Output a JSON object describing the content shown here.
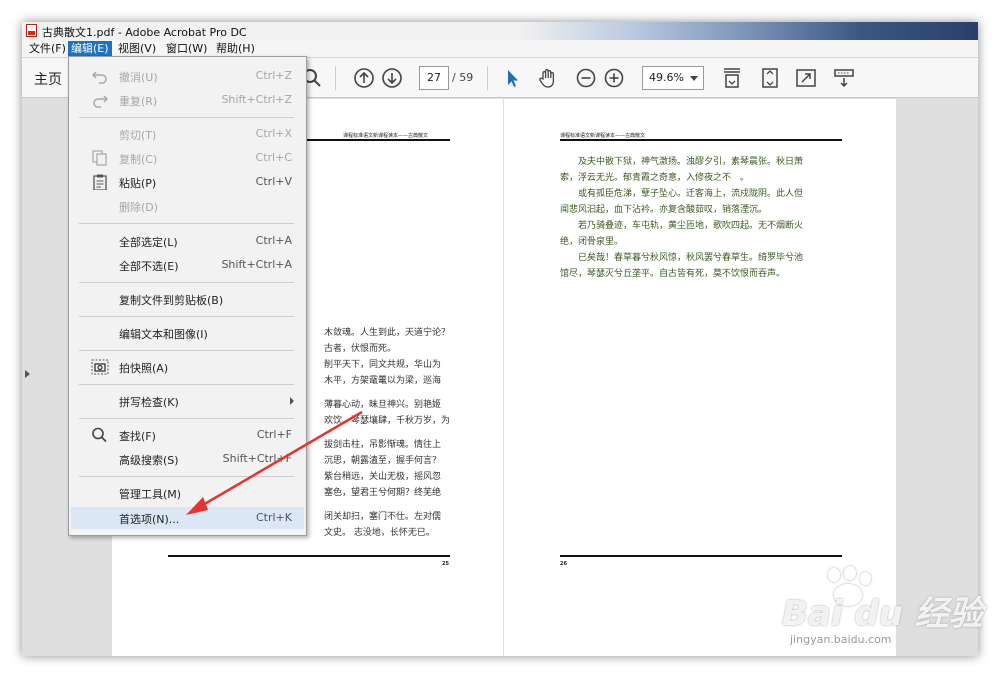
{
  "window": {
    "title": "古典散文1.pdf - Adobe Acrobat Pro DC"
  },
  "menubar": [
    {
      "label": "文件(F)",
      "active": false
    },
    {
      "label": "编辑(E)",
      "active": true
    },
    {
      "label": "视图(V)",
      "active": false
    },
    {
      "label": "窗口(W)",
      "active": false
    },
    {
      "label": "帮助(H)",
      "active": false
    }
  ],
  "toolbar": {
    "home_label": "主页",
    "page_current": "27",
    "page_total": "/ 59",
    "zoom": "49.6%"
  },
  "edit_menu": {
    "undo": {
      "label": "撤消(U)",
      "shortcut": "Ctrl+Z"
    },
    "redo": {
      "label": "重复(R)",
      "shortcut": "Shift+Ctrl+Z"
    },
    "cut": {
      "label": "剪切(T)",
      "shortcut": "Ctrl+X"
    },
    "copy": {
      "label": "复制(C)",
      "shortcut": "Ctrl+C"
    },
    "paste": {
      "label": "粘贴(P)",
      "shortcut": "Ctrl+V"
    },
    "delete": {
      "label": "删除(D)",
      "shortcut": ""
    },
    "select_all": {
      "label": "全部选定(L)",
      "shortcut": "Ctrl+A"
    },
    "deselect_all": {
      "label": "全部不选(E)",
      "shortcut": "Shift+Ctrl+A"
    },
    "copy_file_clipboard": {
      "label": "复制文件到剪贴板(B)",
      "shortcut": ""
    },
    "edit_text_images": {
      "label": "编辑文本和图像(I)",
      "shortcut": ""
    },
    "snapshot": {
      "label": "拍快照(A)",
      "shortcut": ""
    },
    "spell_check": {
      "label": "拼写检查(K)",
      "shortcut": ""
    },
    "find": {
      "label": "查找(F)",
      "shortcut": "Ctrl+F"
    },
    "advanced_search": {
      "label": "高级搜索(S)",
      "shortcut": "Shift+Ctrl+F"
    },
    "manage_tools": {
      "label": "管理工具(M)",
      "shortcut": ""
    },
    "preferences": {
      "label": "首选项(N)...",
      "shortcut": "Ctrl+K"
    }
  },
  "left_page": {
    "header": "课程标准语文新课程读本——古典散文",
    "page_number": "25",
    "lines": [
      "木敛魂。人生到此，天道宁论？",
      "古者，伏恨而死。",
      "削平天下，同文共规，华山为",
      "木平，方架鼋鼍以为梁，巡海",
      "薄暮心动，昧旦神兴。别艳姬",
      "欢饮，琴瑟壤肆，千秋万岁，为",
      "拔剑击柱，吊影惭魂。情往上",
      "沉思，朝露溘至，握手何言？",
      "紫台稍远，关山无极，摇风忽",
      "塞色，望君王兮何期？终芜绝",
      "闭关却扫，塞门不仕。左对儒",
      "文史。 志没地，长怀无已。"
    ]
  },
  "right_page": {
    "header": "课程标准语文新课程读本——古典散文",
    "page_number": "26",
    "lines": [
      "及夫中散下狱，神气激扬。浊醪夕引，素琴晨张。秋日萧",
      "索，浮云无光。郁青霞之奇意，入修夜之不　。",
      "或有孤臣危涕，孽子坠心。迁客海上，流戍陇阴。此人但",
      "闻悲风汩起，血下沾衿。亦复含酸茹叹，销落湮沉。",
      "若乃骑叠迹，车屯轨，黄尘匝地，歌吹四起。无不烟断火",
      "绝，闭骨泉里。",
      "已矣哉！春草暮兮秋风惊，秋风罢兮春草生。绮罗毕兮池",
      "馆尽，琴瑟灭兮丘垄平。自古皆有死，莫不饮恨而吞声。"
    ]
  },
  "watermark": {
    "main": "Bai du 经验",
    "sub": "jingyan.baidu.com"
  }
}
